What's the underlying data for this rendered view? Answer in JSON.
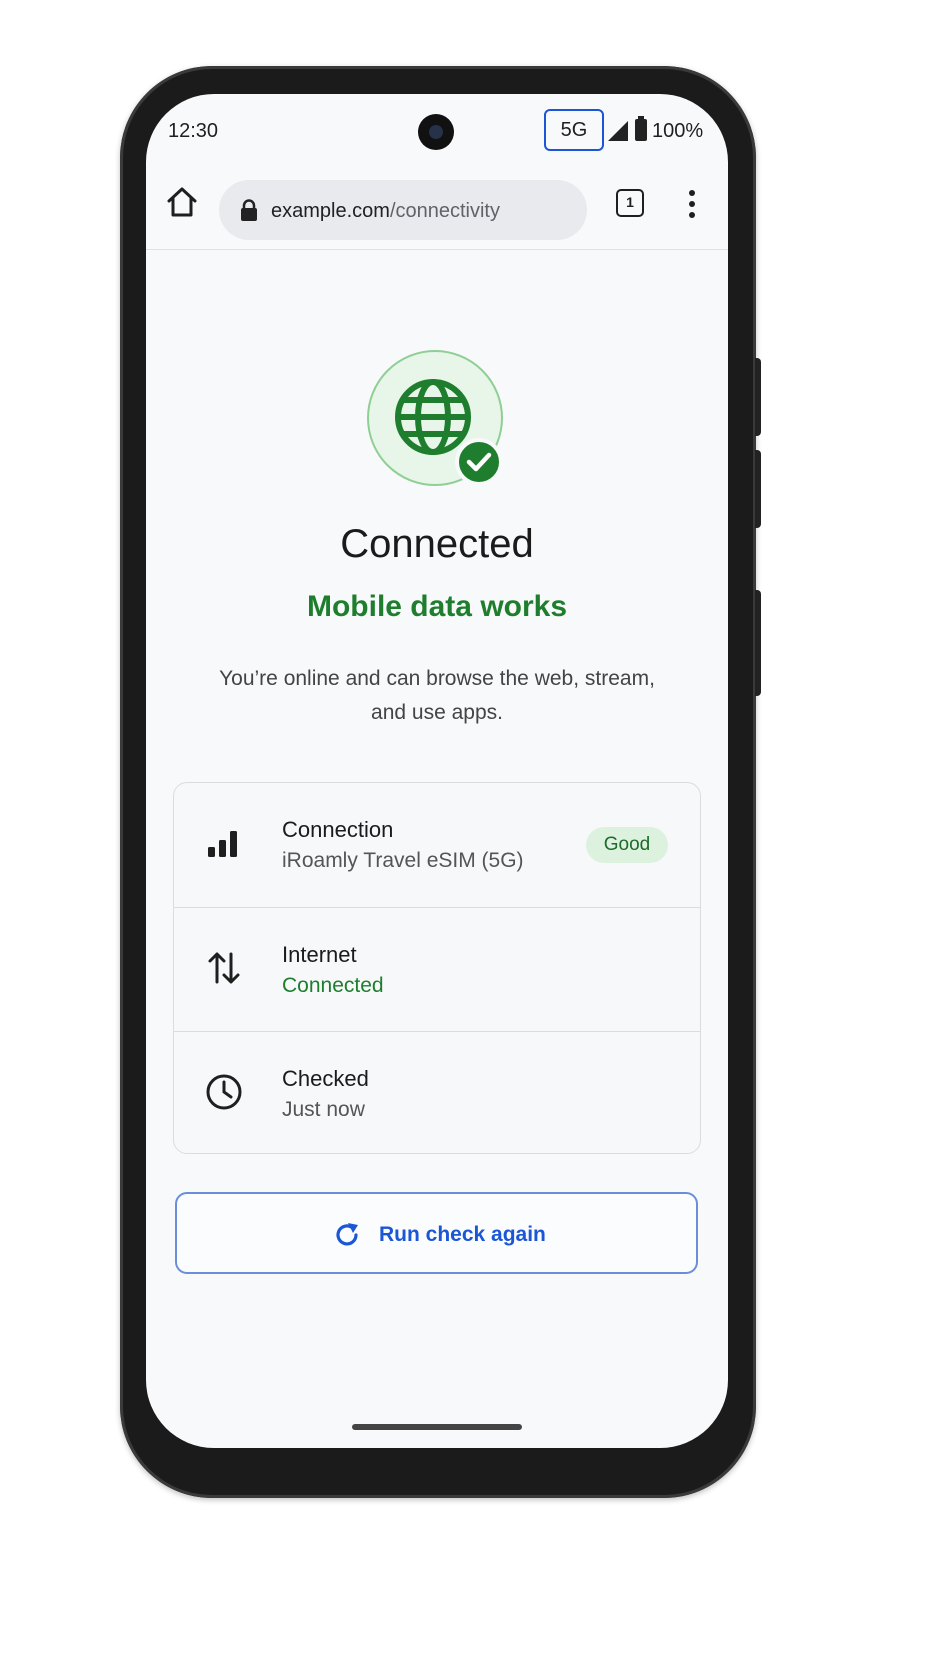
{
  "status_bar": {
    "time": "12:30",
    "network": "5G",
    "battery": "100%"
  },
  "browser": {
    "url_domain": "example.com",
    "url_path": "/connectivity",
    "tab_count": "1"
  },
  "hero": {
    "icon": "globe-check-icon",
    "title": "Connected",
    "subtitle": "Mobile data works",
    "description": "You’re online and can browse the web, stream, and use apps."
  },
  "details": [
    {
      "icon": "signal-bars-icon",
      "title": "Connection",
      "value": "iRoamly Travel eSIM (5G)",
      "badge": "Good"
    },
    {
      "icon": "data-transfer-icon",
      "title": "Internet",
      "value": "Connected"
    },
    {
      "icon": "clock-icon",
      "title": "Checked",
      "value": "Just now"
    }
  ],
  "actions": {
    "rerun_label": "Run check again",
    "rerun_icon": "refresh-icon"
  },
  "colors": {
    "success": "#1e7e2e",
    "accent": "#1a56d6",
    "badge_bg": "#dcf2df"
  }
}
